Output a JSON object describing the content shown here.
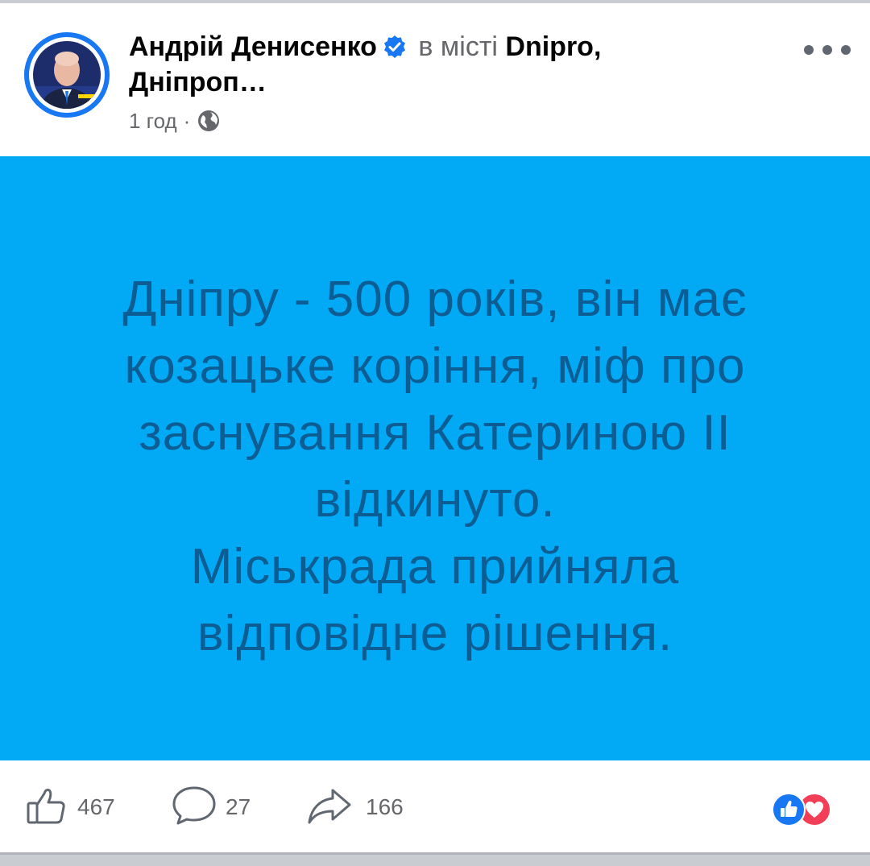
{
  "post": {
    "author": "Андрій Денисенко",
    "location_prefix": "в місті",
    "location_name": "Dnipro,",
    "region": "Дніпроп…",
    "time": "1 год",
    "separator": "·",
    "privacy_icon": "globe-icon",
    "verified_icon": "verified-badge-icon",
    "more_icon": "more-options-icon"
  },
  "content": {
    "background_color": "#02a9f4",
    "text_color": "#0b5d93",
    "lines": [
      "Дніпру - 500 років, він має",
      "козацьке коріння, міф про",
      "заснування Катериною ІІ",
      "відкинуто.",
      "Міськрада прийняла",
      "відповідне рішення."
    ]
  },
  "footer": {
    "likes": "467",
    "comments": "27",
    "shares": "166",
    "like_icon": "thumbs-up-icon",
    "comment_icon": "comment-bubble-icon",
    "share_icon": "share-arrow-icon",
    "reactions": [
      "like-reaction-icon",
      "love-reaction-icon"
    ]
  },
  "colors": {
    "verified": "#1877f2",
    "like_reaction": "#1877f2",
    "love_reaction": "#f33e58"
  }
}
